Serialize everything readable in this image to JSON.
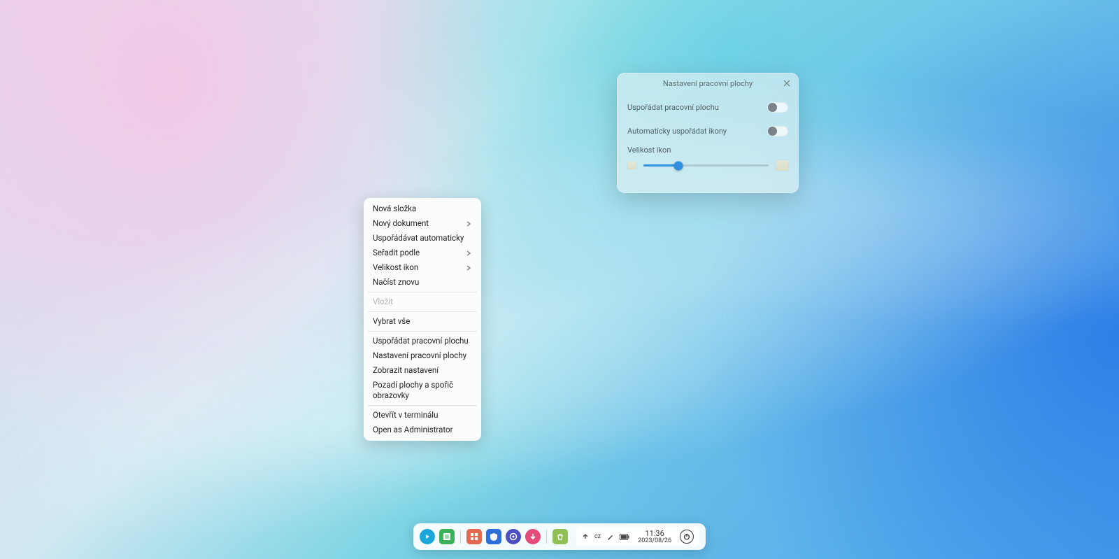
{
  "context_menu": {
    "items": [
      {
        "label": "Nová složka",
        "submenu": false,
        "disabled": false
      },
      {
        "label": "Nový dokument",
        "submenu": true,
        "disabled": false
      },
      {
        "label": "Uspořádávat automaticky",
        "submenu": false,
        "disabled": false
      },
      {
        "label": "Seřadit podle",
        "submenu": true,
        "disabled": false
      },
      {
        "label": "Velikost ikon",
        "submenu": true,
        "disabled": false
      },
      {
        "label": "Načíst znovu",
        "submenu": false,
        "disabled": false
      },
      {
        "label": "Vložit",
        "submenu": false,
        "disabled": true
      },
      {
        "label": "Vybrat vše",
        "submenu": false,
        "disabled": false
      },
      {
        "label": "Uspořádat pracovní plochu",
        "submenu": false,
        "disabled": false
      },
      {
        "label": "Nastavení pracovní plochy",
        "submenu": false,
        "disabled": false
      },
      {
        "label": "Zobrazit nastavení",
        "submenu": false,
        "disabled": false
      },
      {
        "label": "Pozadí plochy a spořič obrazovky",
        "submenu": false,
        "disabled": false
      },
      {
        "label": "Otevřít v terminálu",
        "submenu": false,
        "disabled": false
      },
      {
        "label": "Open as Administrator",
        "submenu": false,
        "disabled": false
      }
    ],
    "separators_after": [
      5,
      6,
      7,
      11
    ]
  },
  "settings_panel": {
    "title": "Nastavení pracovní plochy",
    "row1": "Uspořádat pracovní plochu",
    "row1_on": false,
    "row2": "Automaticky uspořádat ikony",
    "row2_on": false,
    "slider_label": "Velikost ikon",
    "slider_percent": 28
  },
  "dock": {
    "icons": [
      {
        "name": "launcher-icon",
        "bg": "#1aa6d9",
        "style": "circ",
        "glyph": "play"
      },
      {
        "name": "file-manager-icon",
        "bg": "#3db15a",
        "style": "rect",
        "glyph": "sheet"
      },
      {
        "name": "app-store-icon",
        "bg": "#e36a4e",
        "style": "rect",
        "glyph": "grid"
      },
      {
        "name": "browser-icon",
        "bg": "#2d6fd8",
        "style": "rect",
        "glyph": "shield"
      },
      {
        "name": "control-center-icon",
        "bg": "#4b4fbf",
        "style": "circ",
        "glyph": "gear"
      },
      {
        "name": "downloads-icon",
        "bg": "#e34b78",
        "style": "circ",
        "glyph": "down"
      },
      {
        "name": "trash-icon",
        "bg": "#8fbf55",
        "style": "rect",
        "glyph": "trash"
      }
    ]
  },
  "tray": {
    "lang": "cz",
    "time": "11:36",
    "date": "2023/08/26"
  }
}
